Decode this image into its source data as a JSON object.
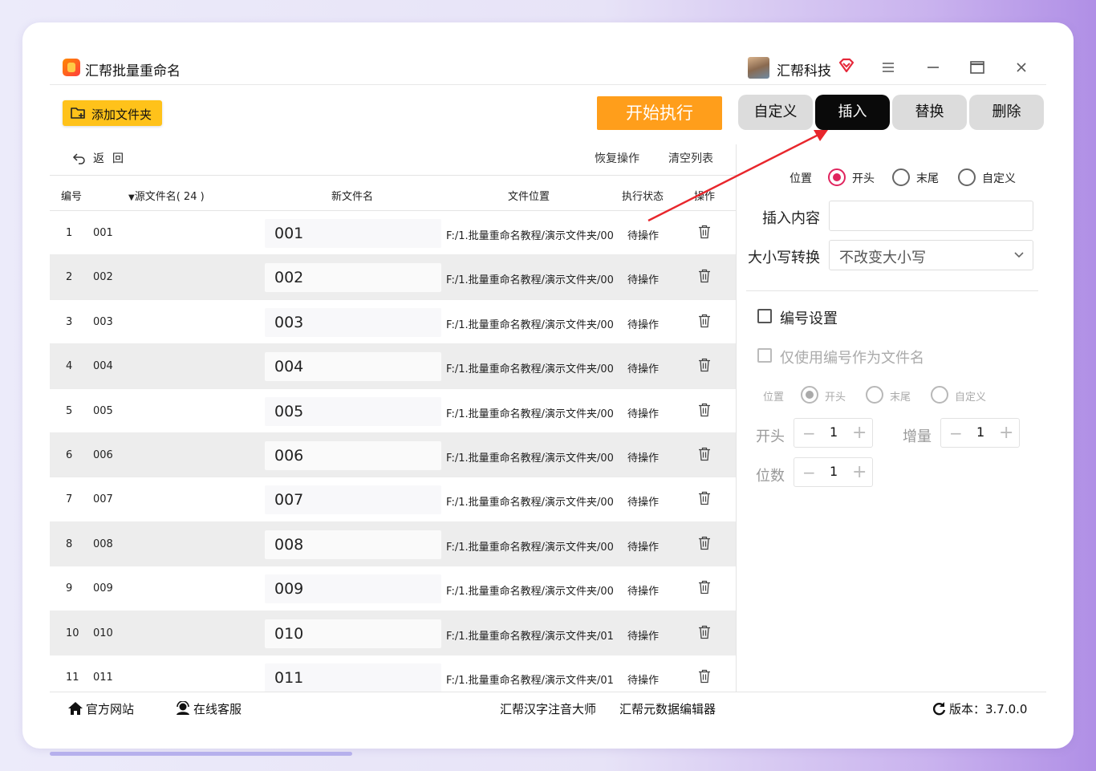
{
  "app": {
    "title": "汇帮批量重命名",
    "company": "汇帮科技"
  },
  "toolbar": {
    "add_folder": "添加文件夹",
    "start": "开始执行",
    "undo": "返回",
    "restore": "恢复操作",
    "clear": "清空列表"
  },
  "tabs": [
    {
      "label": "自定义",
      "active": false
    },
    {
      "label": "插入",
      "active": true
    },
    {
      "label": "替换",
      "active": false
    },
    {
      "label": "删除",
      "active": false
    }
  ],
  "table": {
    "headers": {
      "num": "编号",
      "source": "源文件名",
      "count": "( 24 )",
      "new": "新文件名",
      "location": "文件位置",
      "status": "执行状态",
      "action": "操作"
    },
    "rows": [
      {
        "num": "1",
        "source": "001",
        "new": "001",
        "path": "F:/1.批量重命名教程/演示文件夹/00",
        "status": "待操作"
      },
      {
        "num": "2",
        "source": "002",
        "new": "002",
        "path": "F:/1.批量重命名教程/演示文件夹/00",
        "status": "待操作"
      },
      {
        "num": "3",
        "source": "003",
        "new": "003",
        "path": "F:/1.批量重命名教程/演示文件夹/00",
        "status": "待操作"
      },
      {
        "num": "4",
        "source": "004",
        "new": "004",
        "path": "F:/1.批量重命名教程/演示文件夹/00",
        "status": "待操作"
      },
      {
        "num": "5",
        "source": "005",
        "new": "005",
        "path": "F:/1.批量重命名教程/演示文件夹/00",
        "status": "待操作"
      },
      {
        "num": "6",
        "source": "006",
        "new": "006",
        "path": "F:/1.批量重命名教程/演示文件夹/00",
        "status": "待操作"
      },
      {
        "num": "7",
        "source": "007",
        "new": "007",
        "path": "F:/1.批量重命名教程/演示文件夹/00",
        "status": "待操作"
      },
      {
        "num": "8",
        "source": "008",
        "new": "008",
        "path": "F:/1.批量重命名教程/演示文件夹/00",
        "status": "待操作"
      },
      {
        "num": "9",
        "source": "009",
        "new": "009",
        "path": "F:/1.批量重命名教程/演示文件夹/00",
        "status": "待操作"
      },
      {
        "num": "10",
        "source": "010",
        "new": "010",
        "path": "F:/1.批量重命名教程/演示文件夹/01",
        "status": "待操作"
      },
      {
        "num": "11",
        "source": "011",
        "new": "011",
        "path": "F:/1.批量重命名教程/演示文件夹/01",
        "status": "待操作"
      }
    ]
  },
  "insert_panel": {
    "position_label": "位置",
    "position_options": [
      "开头",
      "末尾",
      "自定义"
    ],
    "position_selected": "开头",
    "content_label": "插入内容",
    "content_value": "",
    "case_label": "大小写转换",
    "case_value": "不改变大小写"
  },
  "numbering": {
    "enable_label": "编号设置",
    "only_number_label": "仅使用编号作为文件名",
    "position_label": "位置",
    "position_options": [
      "开头",
      "末尾",
      "自定义"
    ],
    "start_label": "开头",
    "start_value": "1",
    "increment_label": "增量",
    "increment_value": "1",
    "digits_label": "位数",
    "digits_value": "1"
  },
  "footer": {
    "website": "官方网站",
    "support": "在线客服",
    "pinyin": "汇帮汉字注音大师",
    "metadata": "汇帮元数据编辑器",
    "version": "版本：3.7.0.0"
  },
  "colors": {
    "accent_orange": "#ff9e1b",
    "button_yellow": "#ffc21a",
    "radio_selected": "#e0245e",
    "arrow_red": "#e8262c"
  }
}
